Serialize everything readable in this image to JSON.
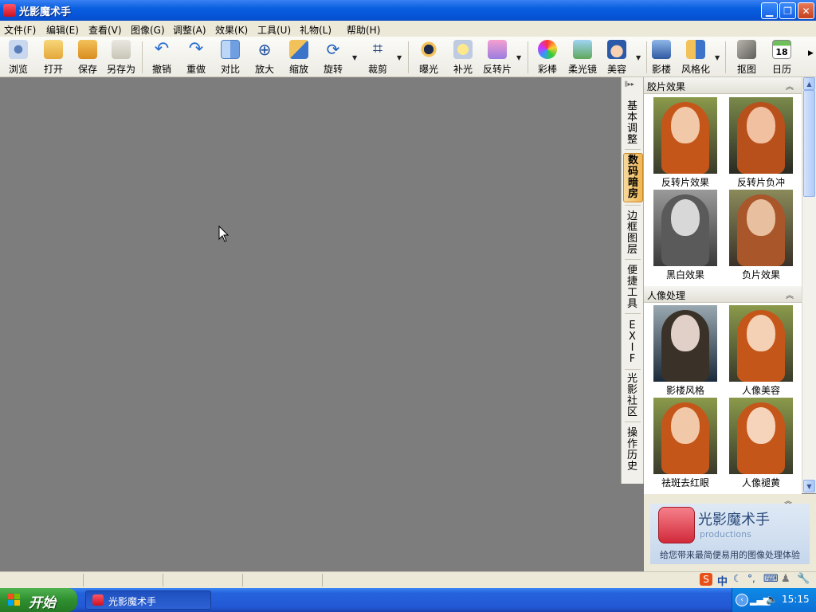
{
  "window": {
    "title": "光影魔术手"
  },
  "menu": [
    "文件(F)",
    "编辑(E)",
    "查看(V)",
    "图像(G)",
    "调整(A)",
    "效果(K)",
    "工具(U)",
    "礼物(L)",
    "帮助(H)"
  ],
  "toolbar": {
    "browse": "浏览",
    "open": "打开",
    "save": "保存",
    "save_as": "另存为",
    "undo": "撤销",
    "redo": "重做",
    "compare": "对比",
    "zoom_in": "放大",
    "resize": "缩放",
    "rotate": "旋转",
    "crop": "裁剪",
    "exposure": "曝光",
    "fill_light": "补光",
    "reverse_film": "反转片",
    "colorize": "彩棒",
    "soft_lens": "柔光镜",
    "beauty": "美容",
    "studio": "影楼",
    "stylize": "风格化",
    "cutout": "抠图",
    "calendar": "日历",
    "calendar_day": "18"
  },
  "side_tabs": [
    "基本调整",
    "数码暗房",
    "边框图层",
    "便捷工具",
    "EXIF",
    "光影社区",
    "操作历史"
  ],
  "side_tabs_active": "数码暗房",
  "panel": {
    "sections": [
      {
        "title": "胶片效果",
        "items": [
          "反转片效果",
          "反转片负冲",
          "黑白效果",
          "负片效果"
        ]
      },
      {
        "title": "人像处理",
        "items": [
          "影楼风格",
          "人像美容",
          "祛斑去红眼",
          "人像褪黄"
        ]
      }
    ]
  },
  "ad": {
    "name": "光影魔术手",
    "sub": "productions",
    "slogan": "给您带来最简便易用的图像处理体验"
  },
  "taskbar": {
    "start": "开始",
    "task": "光影魔术手",
    "time": "15:15",
    "ime": "中"
  }
}
